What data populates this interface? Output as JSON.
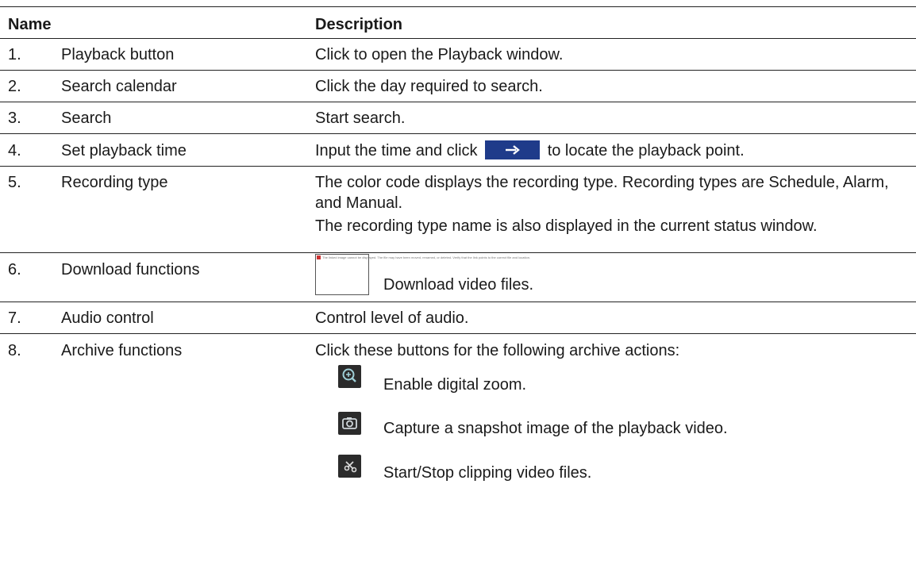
{
  "header": {
    "name": "Name",
    "description": "Description"
  },
  "rows": [
    {
      "num": "1.",
      "name": "Playback button",
      "desc": "Click to open the Playback window."
    },
    {
      "num": "2.",
      "name": "Search calendar",
      "desc": "Click the day required to search."
    },
    {
      "num": "3.",
      "name": "Search",
      "desc": "Start search."
    },
    {
      "num": "4.",
      "name": "Set playback time",
      "desc_before": "Input the time and click",
      "desc_after": "to locate the playback point.",
      "icon": "arrow-right-icon"
    },
    {
      "num": "5.",
      "name": "Recording type",
      "desc": "The color code displays the recording type. Recording types are Schedule, Alarm, and Manual.",
      "desc2": "The recording type name is also displayed in the current status window."
    },
    {
      "num": "6.",
      "name": "Download functions",
      "desc": "Download video files.",
      "icon": "broken-image-icon",
      "broken_text": "The linked image cannot be displayed. The file may have been moved, renamed, or deleted. Verify that the link points to the correct file and location."
    },
    {
      "num": "7.",
      "name": "Audio control",
      "desc": "Control level of audio."
    },
    {
      "num": "8.",
      "name": "Archive functions",
      "desc": "Click these buttons for the following archive actions:",
      "actions": [
        {
          "icon": "zoom-icon",
          "label": "Enable digital zoom."
        },
        {
          "icon": "camera-icon",
          "label": "Capture a snapshot image of the playback video."
        },
        {
          "icon": "scissors-icon",
          "label": "Start/Stop clipping video files."
        }
      ]
    }
  ]
}
